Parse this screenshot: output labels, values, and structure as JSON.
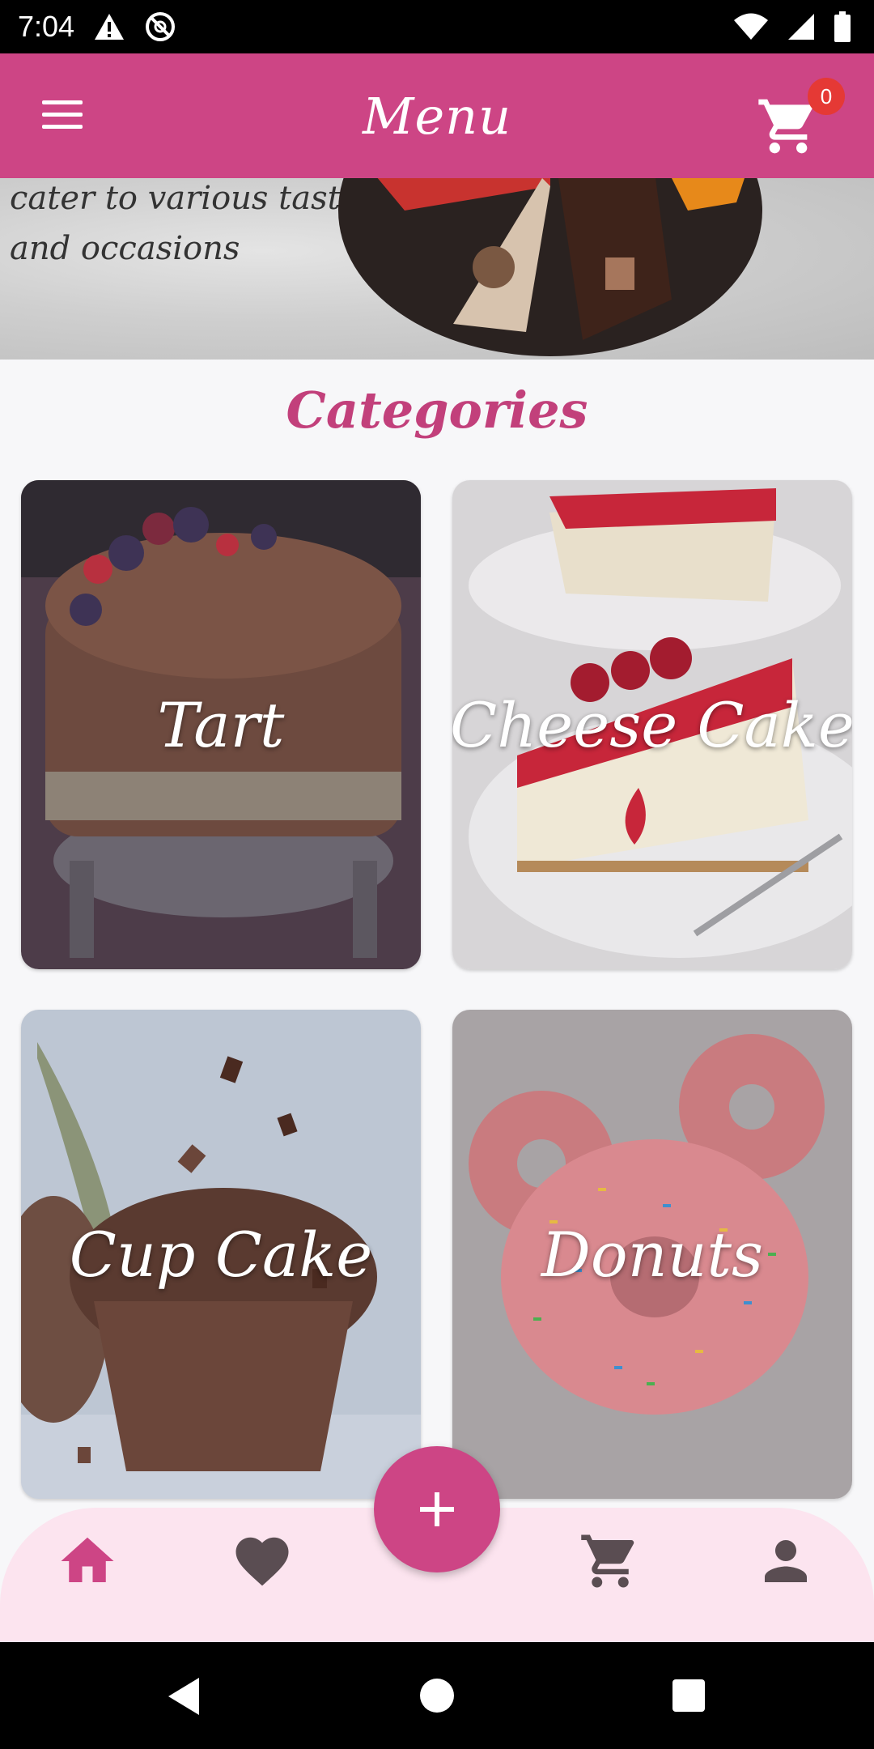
{
  "status_bar": {
    "time": "7:04"
  },
  "app_bar": {
    "title": "Menu",
    "cart_count": "0"
  },
  "banner": {
    "text_line1": "cater to various tastes",
    "text_line2": "and occasions"
  },
  "section": {
    "title": "Categories"
  },
  "categories": [
    {
      "label": "Tart"
    },
    {
      "label": "Cheese Cake"
    },
    {
      "label": "Cup Cake"
    },
    {
      "label": "Donuts"
    }
  ],
  "bottom_nav": {
    "items": [
      "home-icon",
      "heart-icon",
      "cart-icon",
      "person-icon"
    ],
    "active": "home-icon",
    "fab_icon": "plus-icon"
  },
  "colors": {
    "primary": "#cd4585",
    "nav_background": "#fce4ef",
    "badge": "#e53935",
    "inactive_icon": "#5a4d52"
  }
}
